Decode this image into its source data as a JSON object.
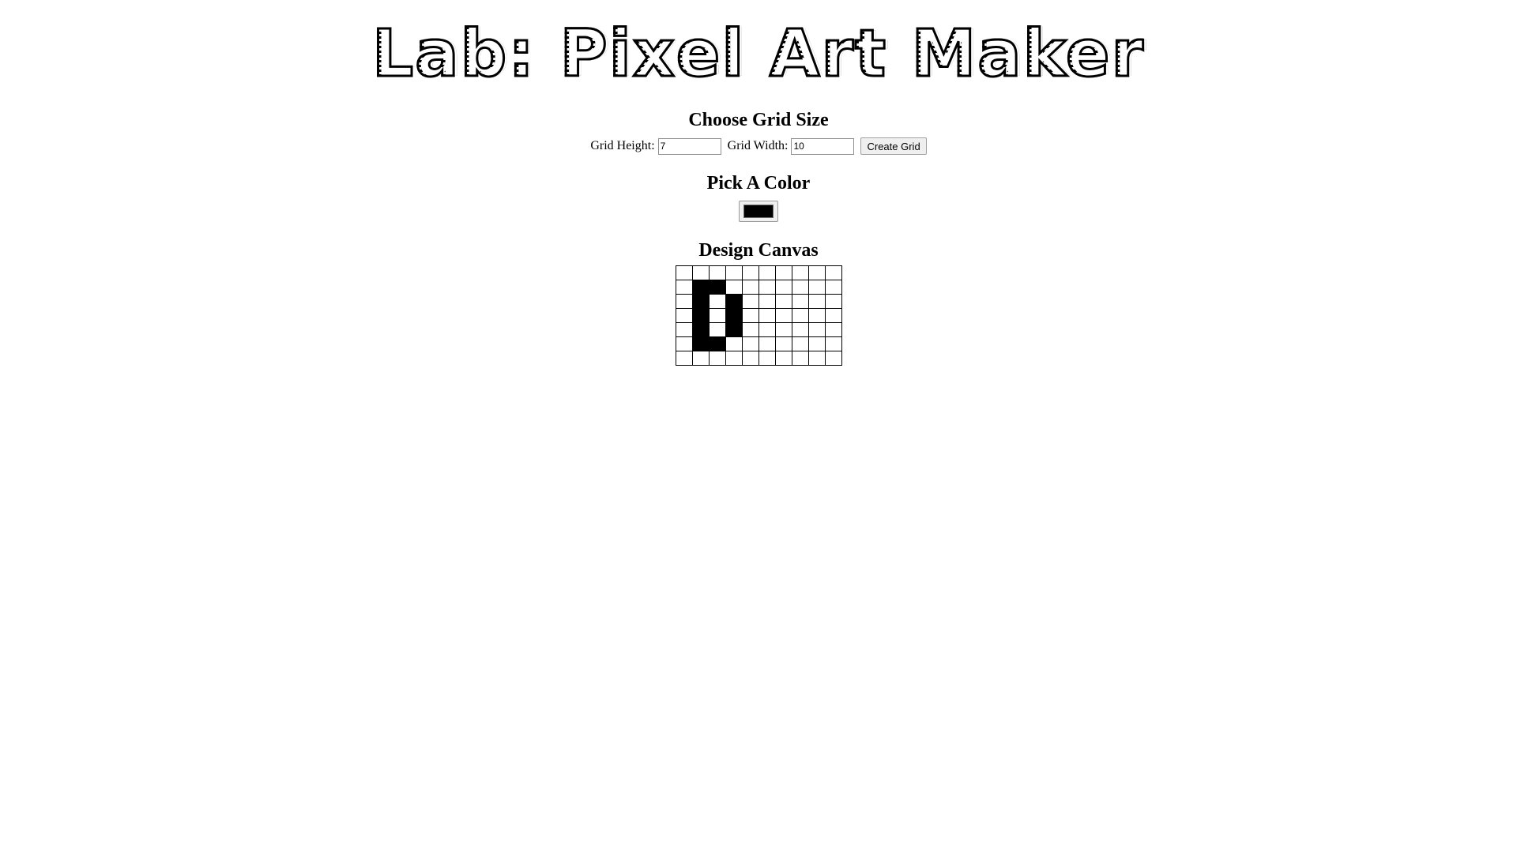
{
  "logo": {
    "text": "Lab: Pixel Art Maker"
  },
  "grid_size": {
    "heading": "Choose Grid Size",
    "height_label": "Grid Height:",
    "height_value": "7",
    "width_label": "Grid Width:",
    "width_value": "10",
    "submit_label": "Create Grid"
  },
  "color": {
    "heading": "Pick A Color",
    "value": "#000000"
  },
  "canvas": {
    "heading": "Design Canvas",
    "rows": 7,
    "cols": 10,
    "fill_color": "#000000",
    "filled_cells": [
      [
        1,
        1
      ],
      [
        1,
        2
      ],
      [
        2,
        1
      ],
      [
        2,
        3
      ],
      [
        3,
        1
      ],
      [
        3,
        3
      ],
      [
        4,
        1
      ],
      [
        4,
        3
      ],
      [
        5,
        1
      ],
      [
        5,
        2
      ]
    ]
  }
}
